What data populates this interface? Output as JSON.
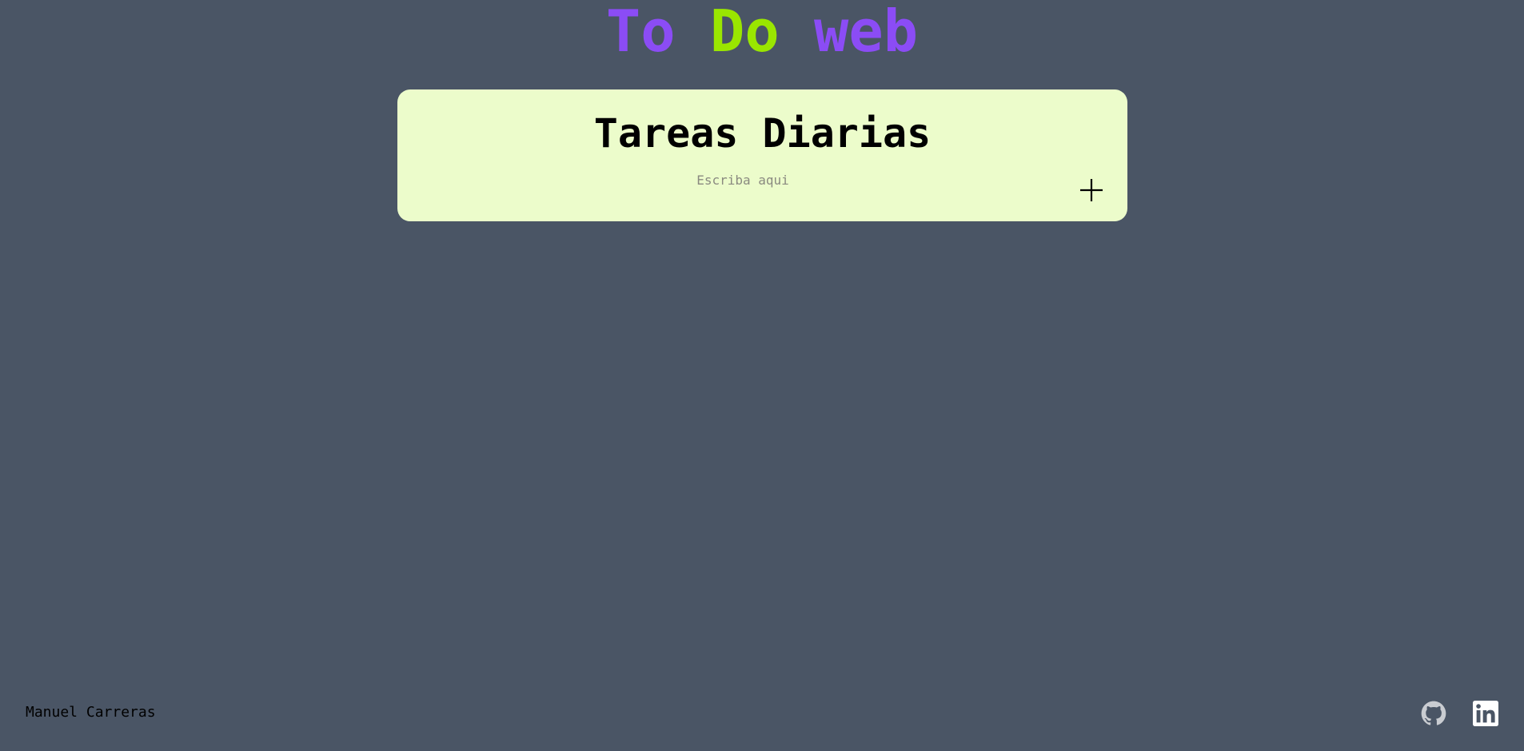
{
  "header": {
    "title_words": [
      "To",
      "Do",
      "web"
    ]
  },
  "card": {
    "title": "Tareas Diarias",
    "input_placeholder": "Escriba aqui",
    "input_value": "",
    "add_button_icon": "plus-icon"
  },
  "footer": {
    "author": "Manuel Carreras",
    "links": [
      {
        "icon": "github-icon"
      },
      {
        "icon": "linkedin-icon"
      }
    ]
  },
  "colors": {
    "background": "#4a5565",
    "card": "#ecfccb",
    "title_purple": "#8b4cf5",
    "title_green": "#9ae600"
  }
}
